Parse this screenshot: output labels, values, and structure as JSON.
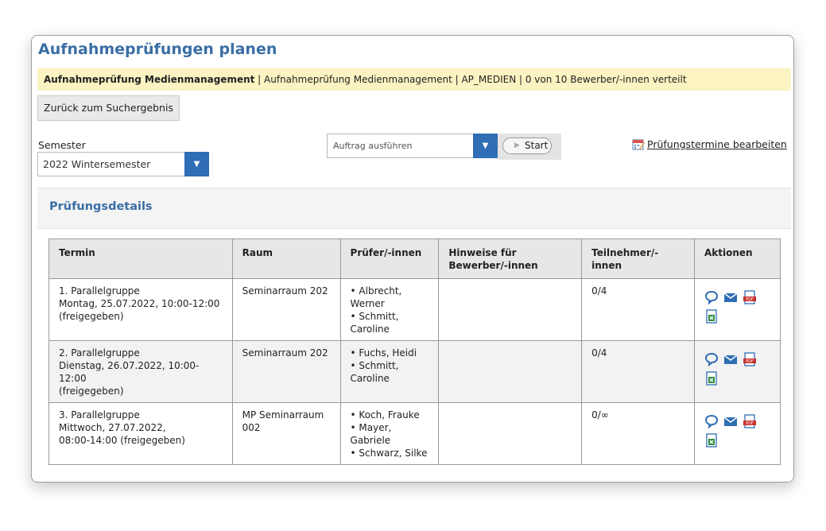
{
  "page": {
    "title": "Aufnahmeprüfungen planen"
  },
  "infobar": {
    "bold": "Aufnahmeprüfung Medienmanagement",
    "rest": " | Aufnahmeprüfung Medienmanagement | AP_MEDIEN | 0 von 10 Bewerber/-innen verteilt"
  },
  "back_button": "Zurück zum Suchergebnis",
  "semester": {
    "label": "Semester",
    "value": "2022 Wintersemester"
  },
  "job": {
    "placeholder": "Auftrag ausführen",
    "start_label": "Start"
  },
  "edit_link": "Prüfungstermine bearbeiten",
  "details": {
    "heading": "Prüfungsdetails",
    "columns": [
      "Termin",
      "Raum",
      "Prüfer/-innen",
      "Hinweise für Bewerber/-innen",
      "Teilnehmer/-innen",
      "Aktionen"
    ],
    "rows": [
      {
        "termin": [
          "1. Parallelgruppe",
          "Montag, 25.07.2022, 10:00-12:00",
          "(freigegeben)"
        ],
        "raum": "Seminarraum 202",
        "pruefer": [
          "• Albrecht,",
          "Werner",
          "• Schmitt,",
          "Caroline"
        ],
        "hinweise": "",
        "teilnehmer": "0/4"
      },
      {
        "termin": [
          "2. Parallelgruppe",
          "Dienstag, 26.07.2022, 10:00-12:00",
          "(freigegeben)"
        ],
        "raum": "Seminarraum 202",
        "pruefer": [
          "• Fuchs, Heidi",
          "• Schmitt,",
          "Caroline"
        ],
        "hinweise": "",
        "teilnehmer": "0/4"
      },
      {
        "termin": [
          "3. Parallelgruppe",
          "Mittwoch, 27.07.2022,",
          "08:00-14:00 (freigegeben)"
        ],
        "raum": "MP Seminarraum 002",
        "pruefer": [
          "• Koch, Frauke",
          "• Mayer,",
          "Gabriele",
          "• Schwarz, Silke"
        ],
        "hinweise": "",
        "teilnehmer": "0/∞"
      }
    ],
    "action_icons": [
      "comment-icon",
      "mail-icon",
      "pdf-icon",
      "excel-icon"
    ]
  },
  "colors": {
    "title": "#3a6ea5",
    "accent": "#2f6db5",
    "infobar_bg": "#fbf3c2"
  }
}
